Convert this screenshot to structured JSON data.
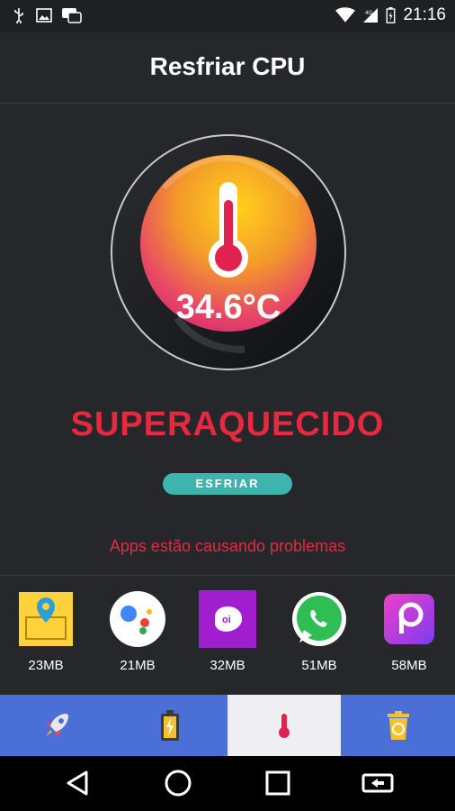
{
  "status_bar": {
    "time": "21:16",
    "left_icons": [
      "usb-icon",
      "image-icon",
      "chat-icon"
    ],
    "right_icons": [
      "wifi-icon",
      "signal-4g-icon",
      "battery-icon"
    ]
  },
  "header": {
    "title": "Resfriar CPU"
  },
  "gauge": {
    "temperature": "34.6°C",
    "icon": "thermometer-icon"
  },
  "status_label": "SUPERAQUECIDO",
  "cool_button": "ESFRIAR",
  "warning": "Apps estão causando problemas",
  "apps": [
    {
      "icon": "maps-app-icon",
      "size": "23MB"
    },
    {
      "icon": "google-assistant-icon",
      "size": "21MB"
    },
    {
      "icon": "oi-app-icon",
      "size": "32MB"
    },
    {
      "icon": "whatsapp-icon",
      "size": "51MB"
    },
    {
      "icon": "picsart-icon",
      "size": "58MB"
    }
  ],
  "tabs": [
    {
      "icon": "rocket-icon",
      "active": false
    },
    {
      "icon": "battery-charge-icon",
      "active": false
    },
    {
      "icon": "thermometer-icon",
      "active": true
    },
    {
      "icon": "trash-recycle-icon",
      "active": false
    }
  ],
  "nav": [
    "back-icon",
    "home-icon",
    "recents-icon",
    "screen-rotate-icon"
  ],
  "colors": {
    "background": "#26272b",
    "danger": "#e8283f",
    "accent_button": "#3eb4ae",
    "tab_bar": "#4a6fd6",
    "tab_active": "#efeef3"
  }
}
